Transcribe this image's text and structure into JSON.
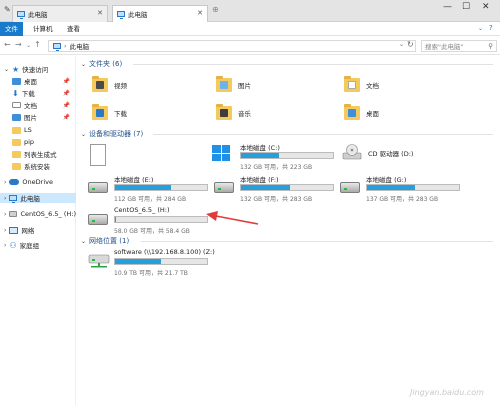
{
  "window": {
    "tabs": [
      {
        "label": "此电脑"
      },
      {
        "label": "此电脑"
      }
    ],
    "controls": {
      "minimize": "—",
      "maximize": "☐",
      "close": "✕"
    }
  },
  "ribbon": {
    "tabs": [
      "文件",
      "计算机",
      "查看"
    ]
  },
  "address": {
    "path": "此电脑",
    "search_placeholder": "搜索\"此电脑\""
  },
  "nav": {
    "quick_access": "快速访问",
    "items": [
      {
        "label": "桌面"
      },
      {
        "label": "下载"
      },
      {
        "label": "文档"
      },
      {
        "label": "图片"
      },
      {
        "label": "LS"
      },
      {
        "label": "pip"
      },
      {
        "label": "列表生成式"
      },
      {
        "label": "系统安装"
      }
    ],
    "onedrive": "OneDrive",
    "this_pc": "此电脑",
    "centos": "CentOS_6.5_ (H:)",
    "network": "网络",
    "homegroup": "家庭组"
  },
  "sections": {
    "folders": "文件夹 (6)",
    "devices": "设备和驱动器 (7)",
    "network": "网络位置 (1)"
  },
  "folders": [
    {
      "label": "视频"
    },
    {
      "label": "图片"
    },
    {
      "label": "文档"
    },
    {
      "label": "下载"
    },
    {
      "label": "音乐"
    },
    {
      "label": "桌面"
    }
  ],
  "drives": [
    {
      "label": "",
      "info": "",
      "fill": 0
    },
    {
      "label": "本地磁盘 (C:)",
      "info": "132 GB 可用，共 223 GB",
      "fill": 0.41
    },
    {
      "label": "CD 驱动器 (D:)",
      "info": "",
      "fill": 0
    },
    {
      "label": "本地磁盘 (E:)",
      "info": "112 GB 可用，共 284 GB",
      "fill": 0.61
    },
    {
      "label": "本地磁盘 (F:)",
      "info": "132 GB 可用，共 283 GB",
      "fill": 0.53
    },
    {
      "label": "本地磁盘 (G:)",
      "info": "137 GB 可用，共 283 GB",
      "fill": 0.52
    },
    {
      "label": "CentOS_6.5_ (H:)",
      "info": "58.0 GB 可用，共 58.4 GB",
      "fill": 0.01
    }
  ],
  "network_items": [
    {
      "label": "software (\\\\192.168.8.100) (Z:)",
      "info": "10.9 TB 可用，共 21.7 TB",
      "fill": 0.5
    }
  ],
  "watermark": "Jingyan.baidu.com"
}
